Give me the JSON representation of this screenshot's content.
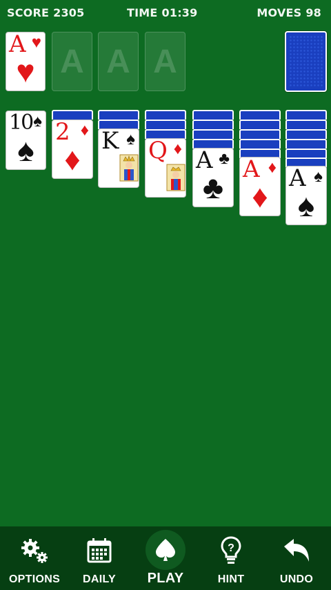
{
  "header": {
    "score_label": "SCORE",
    "score_value": "2305",
    "time_label": "TIME",
    "time_value": "01:39",
    "moves_label": "MOVES",
    "moves_value": "98"
  },
  "foundations": [
    {
      "rank": "A",
      "suit": "♥",
      "color": "red",
      "filled": true
    },
    {
      "placeholder": "A",
      "filled": false
    },
    {
      "placeholder": "A",
      "filled": false
    },
    {
      "placeholder": "A",
      "filled": false
    }
  ],
  "stock": {
    "face_down": true
  },
  "tableau": [
    {
      "hidden": 0,
      "top": {
        "rank": "10",
        "suit": "♠",
        "color": "black"
      }
    },
    {
      "hidden": 1,
      "top": {
        "rank": "2",
        "suit": "♦",
        "color": "red"
      }
    },
    {
      "hidden": 2,
      "top": {
        "rank": "K",
        "suit": "♠",
        "color": "black"
      }
    },
    {
      "hidden": 3,
      "top": {
        "rank": "Q",
        "suit": "♦",
        "color": "red"
      }
    },
    {
      "hidden": 4,
      "top": {
        "rank": "A",
        "suit": "♣",
        "color": "black"
      }
    },
    {
      "hidden": 5,
      "top": {
        "rank": "A",
        "suit": "♦",
        "color": "red"
      }
    },
    {
      "hidden": 6,
      "top": {
        "rank": "A",
        "suit": "♠",
        "color": "black"
      }
    }
  ],
  "toolbar": {
    "options_label": "OPTIONS",
    "daily_label": "DAILY",
    "play_label": "PLAY",
    "hint_label": "HINT",
    "undo_label": "UNDO"
  },
  "colors": {
    "felt": "#0d6b22",
    "toolbar": "#063f12",
    "card_back": "#1a3fbf",
    "red_suit": "#e2171a"
  }
}
